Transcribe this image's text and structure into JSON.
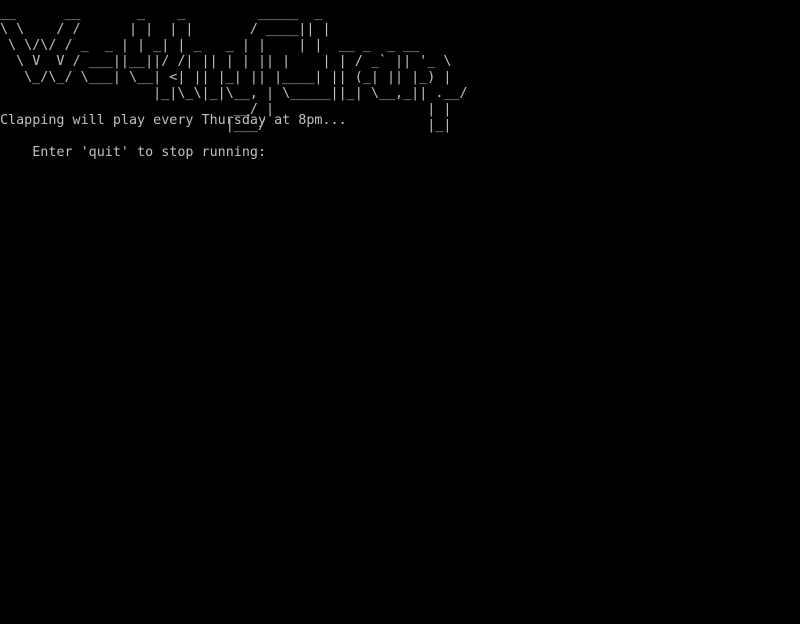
{
  "console": {
    "banner_ascii": "__      __       _    _         _____  _\n\\ \\    / /      | |  | |       / ____|| |\n \\ \\/\\/ / _  _ | | _| | _   _ | |    | |  __ _  _ __\n  \\ V  V / ___||__||/ /| || | | || |    | | / _` || '_ \\\n   \\_/\\_/ \\___| \\__| <| || |_| || |____| || (_| || |_) |\n                   |_|\\_\\|_|\\__, | \\_____||_| \\__,_|| .__/\n                             __/ |                   | |\n                            |___/                    |_|",
    "lines": [
      "Clapping will play every Thursday at 8pm...",
      "Enter 'quit' to stop running:"
    ]
  }
}
